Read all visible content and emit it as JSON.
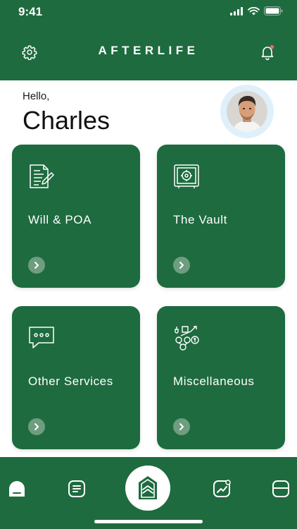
{
  "status_bar": {
    "time": "9:41"
  },
  "header": {
    "title": "AFTERLIFE"
  },
  "greeting": {
    "hello": "Hello,",
    "name": "Charles"
  },
  "cards": [
    {
      "label": "Will & POA",
      "icon": "document-pen-icon"
    },
    {
      "label": "The Vault",
      "icon": "safe-icon"
    },
    {
      "label": "Other Services",
      "icon": "chat-bubble-icon"
    },
    {
      "label": "Miscellaneous",
      "icon": "tools-coins-icon"
    }
  ],
  "tab_bar": {
    "items": [
      "home-icon",
      "list-icon",
      "logo-icon",
      "growth-chart-icon",
      "folder-icon"
    ]
  },
  "colors": {
    "brand_green": "#1e6b3f",
    "arrow_circle": "#6e9d7f",
    "notification_dot": "#e8675c",
    "avatar_ring": "#dff0fb"
  }
}
